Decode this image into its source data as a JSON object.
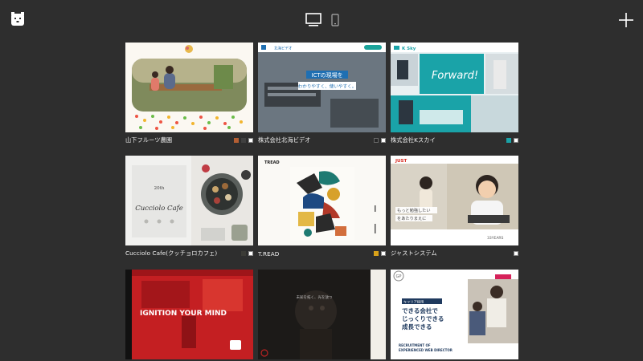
{
  "topbar": {
    "logo_icon": "bear-icon",
    "view_buttons": [
      {
        "name": "desktop-view",
        "icon": "monitor-icon",
        "active": true
      },
      {
        "name": "mobile-view",
        "icon": "phone-icon",
        "active": false
      }
    ],
    "add_icon": "plus-icon"
  },
  "cards": [
    {
      "title": "山下フルーツ農園",
      "swatches": [
        "#b45e33",
        "#404040",
        "#ffffff"
      ],
      "thumb_text": [
        "",
        ""
      ]
    },
    {
      "title": "株式会社北海ビデオ",
      "swatches": [
        "#262626",
        "#ffffff"
      ],
      "thumb_text": [
        "ICTの現場を",
        "わかりやすく、使いやすく。",
        "北海ビデオ"
      ]
    },
    {
      "title": "株式会社Kスカイ",
      "swatches": [
        "#1aa3a8",
        "#ffffff"
      ],
      "thumb_text": [
        "Forward!",
        "K Sky"
      ]
    },
    {
      "title": "Cucciolo Cafe(クッチョロカフェ)",
      "swatches": [
        "#3b3b36",
        "#ffffff"
      ],
      "thumb_text": [
        "20th",
        "Cucciolo Cafe"
      ]
    },
    {
      "title": "T.READ",
      "swatches": [
        "#d9a21a",
        "#ffffff"
      ],
      "thumb_text": [
        "TREAD"
      ]
    },
    {
      "title": "ジャストシステム",
      "swatches": [
        "#ffffff"
      ],
      "thumb_text": [
        "もっと勉強したい",
        "をあたりまえに",
        "JUST",
        "33YEARS"
      ]
    },
    {
      "title": "",
      "swatches": [],
      "thumb_text": [
        "IGNITION YOUR MIND"
      ]
    },
    {
      "title": "",
      "swatches": [],
      "thumb_text": [
        "未知を拓く、光を放つ"
      ]
    },
    {
      "title": "",
      "swatches": [],
      "thumb_text": [
        "できる会社で",
        "じっくりできる",
        "成長できる",
        "RECRUITMENT OF",
        "EXPERIENCED WEB DIRECTOR",
        "キャリア採用",
        "GP"
      ]
    }
  ]
}
